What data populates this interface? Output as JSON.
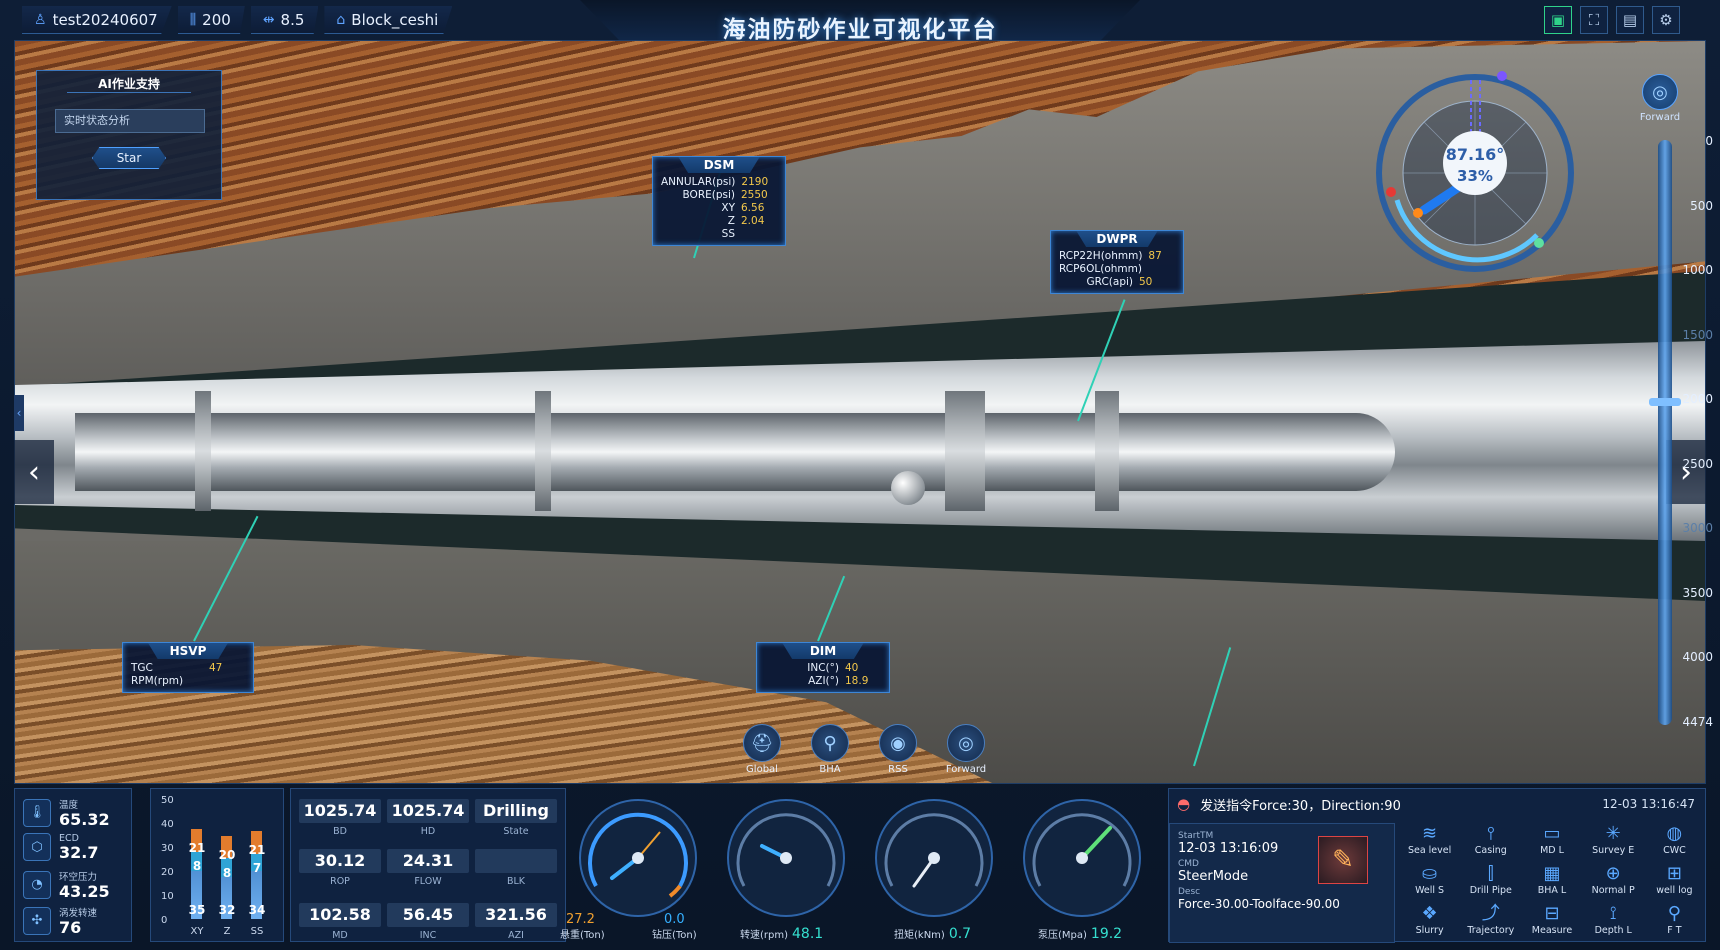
{
  "header": {
    "title": "海油防砂作业可视化平台",
    "chips": [
      {
        "icon": "user-icon",
        "label": "test20240607"
      },
      {
        "icon": "depth-icon",
        "label": "200"
      },
      {
        "icon": "width-icon",
        "label": "8.5"
      },
      {
        "icon": "block-icon",
        "label": "Block_ceshi"
      }
    ]
  },
  "ai_panel": {
    "title": "AI作业支持",
    "select_value": "实时状态分析",
    "button": "Star"
  },
  "callouts": {
    "dsm": {
      "title": "DSM",
      "rows": [
        {
          "k": "ANNULAR(psi)",
          "v": "2190"
        },
        {
          "k": "BORE(psi)",
          "v": "2550"
        },
        {
          "k": "XY",
          "v": "6.56"
        },
        {
          "k": "Z",
          "v": "2.04"
        },
        {
          "k": "SS",
          "v": ""
        }
      ]
    },
    "dwpr": {
      "title": "DWPR",
      "rows": [
        {
          "k": "RCP22H(ohmm)",
          "v": "87"
        },
        {
          "k": "RCP6OL(ohmm)",
          "v": ""
        },
        {
          "k": "GRC(api)",
          "v": "50"
        }
      ]
    },
    "hsvp": {
      "title": "HSVP",
      "rows": [
        {
          "k": "TGC RPM(rpm)",
          "v": "47"
        }
      ]
    },
    "dim": {
      "title": "DIM",
      "rows": [
        {
          "k": "INC(°)",
          "v": "40"
        },
        {
          "k": "AZI(°)",
          "v": "18.9"
        }
      ]
    }
  },
  "compass": {
    "angle": "87.16°",
    "percent": "33%"
  },
  "forward_top": "Forward",
  "depth_scale": {
    "ticks": [
      "0",
      "500",
      "1000",
      "1500",
      "2000",
      "2500",
      "3000",
      "3500",
      "4000",
      "4474"
    ],
    "current": 2000
  },
  "views": [
    {
      "icon": "global-icon",
      "label": "Global"
    },
    {
      "icon": "bha-icon",
      "label": "BHA"
    },
    {
      "icon": "rss-icon",
      "label": "RSS"
    },
    {
      "icon": "forward-icon",
      "label": "Forward"
    }
  ],
  "metrics": [
    {
      "icon": "thermometer-icon",
      "label": "温度",
      "value": "65.32"
    },
    {
      "icon": "cube-icon",
      "label": "ECD",
      "value": "32.7"
    },
    {
      "icon": "gauge-icon",
      "label": "环空压力",
      "value": "43.25"
    },
    {
      "icon": "fan-icon",
      "label": "涡发转速",
      "value": "76"
    }
  ],
  "bar_chart": {
    "yticks": [
      "50",
      "40",
      "30",
      "20",
      "10",
      "0"
    ],
    "ymax": 50,
    "bars": [
      {
        "x": "XY",
        "total": 35,
        "a": 21,
        "b": 8
      },
      {
        "x": "Z",
        "total": 32,
        "a": 20,
        "b": 8
      },
      {
        "x": "SS",
        "total": 34,
        "a": 21,
        "b": 7
      }
    ]
  },
  "stats": [
    {
      "v": "1025.74",
      "l": "BD"
    },
    {
      "v": "1025.74",
      "l": "HD"
    },
    {
      "v": "Drilling",
      "l": "State"
    },
    {
      "v": "30.12",
      "l": "ROP"
    },
    {
      "v": "24.31",
      "l": "FLOW"
    },
    {
      "v": "",
      "l": "BLK"
    },
    {
      "v": "102.58",
      "l": "MD"
    },
    {
      "v": "56.45",
      "l": "INC"
    },
    {
      "v": "321.56",
      "l": "AZI"
    }
  ],
  "gauges": [
    {
      "label": "悬重(Ton)",
      "value": "27.2",
      "label2": "钻压(Ton)",
      "value2": "0.0"
    },
    {
      "label": "转速(rpm)",
      "value": "48.1"
    },
    {
      "label": "扭矩(kNm)",
      "value": "0.7"
    },
    {
      "label": "泵压(Mpa)",
      "value": "19.2"
    }
  ],
  "command": {
    "text": "发送指令Force:30，Direction:90",
    "time": "12-03 13:16:47",
    "start_label": "StartTM",
    "start": "12-03 13:16:09",
    "cmd_label": "CMD",
    "cmd": "SteerMode",
    "desc_label": "Desc",
    "desc": "Force-30.00-Toolface-90.00"
  },
  "tools": [
    {
      "icon": "sea-level-icon",
      "label": "Sea level"
    },
    {
      "icon": "casing-icon",
      "label": "Casing"
    },
    {
      "icon": "md-l-icon",
      "label": "MD L"
    },
    {
      "icon": "survey-icon",
      "label": "Survey E"
    },
    {
      "icon": "cwc-icon",
      "label": "CWC"
    },
    {
      "icon": "well-s-icon",
      "label": "Well S"
    },
    {
      "icon": "drill-pipe-icon",
      "label": "Drill Pipe"
    },
    {
      "icon": "bha-l-icon",
      "label": "BHA L"
    },
    {
      "icon": "normal-p-icon",
      "label": "Normal P"
    },
    {
      "icon": "well-log-icon",
      "label": "well log"
    },
    {
      "icon": "slurry-icon",
      "label": "Slurry"
    },
    {
      "icon": "trajectory-icon",
      "label": "Trajectory"
    },
    {
      "icon": "measure-icon",
      "label": "Measure"
    },
    {
      "icon": "depth-l-icon",
      "label": "Depth L"
    },
    {
      "icon": "ft-icon",
      "label": "F T"
    }
  ]
}
